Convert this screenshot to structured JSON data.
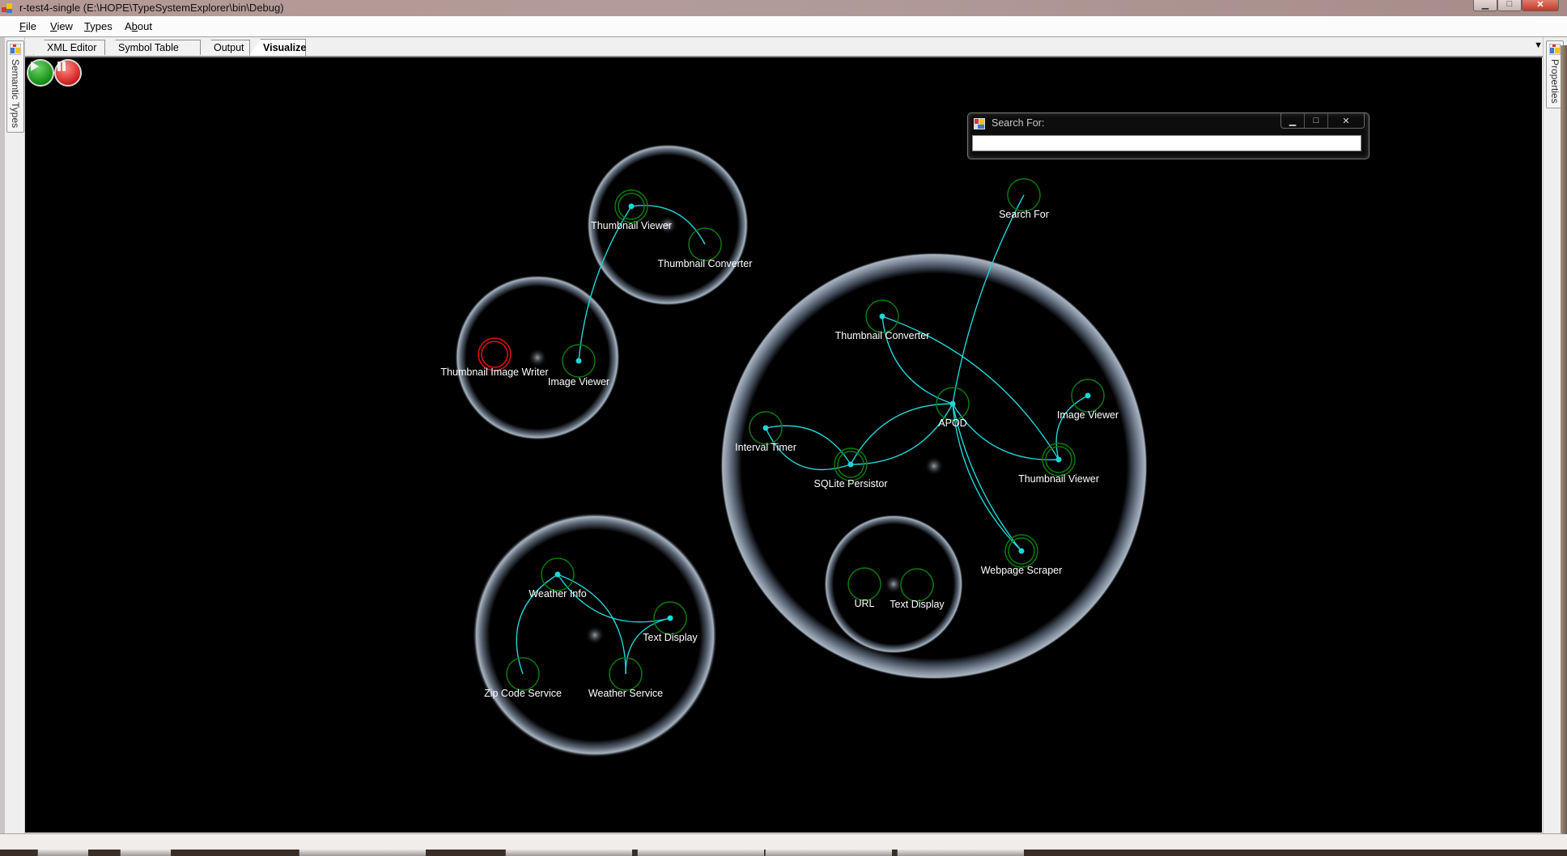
{
  "window": {
    "title": "r-test4-single (E:\\HOPE\\TypeSystemExplorer\\bin\\Debug)",
    "controls": {
      "minimize": "▁",
      "maximize": "□",
      "close": "✕"
    }
  },
  "menu": [
    {
      "label": "File",
      "accel": "F",
      "rest": "ile"
    },
    {
      "label": "View",
      "accel": "V",
      "rest": "iew"
    },
    {
      "label": "Types",
      "accel": "T",
      "rest": "ypes"
    },
    {
      "label": "About",
      "accel_pre": "A",
      "accel": "b",
      "rest": "out"
    }
  ],
  "left_dock": {
    "label": "Semantic Types"
  },
  "right_dock": {
    "label": "Properties"
  },
  "tabs": [
    {
      "label": "XML Editor",
      "active": false
    },
    {
      "label": "Symbol Table",
      "active": false
    },
    {
      "label": "Output",
      "active": false
    },
    {
      "label": "Visualizer",
      "active": true
    }
  ],
  "tab_controls": {
    "menu": "▼",
    "close": "✕"
  },
  "visualizer": {
    "play_button": {
      "icon": "play-icon",
      "color": "#1a9a18"
    },
    "pause_button": {
      "icon": "pause-icon",
      "color": "#d42020"
    },
    "colors": {
      "node_ring": "#0c7a0c",
      "node_ring_error": "#e01010",
      "connection": "#1ed6d6",
      "group_ring": "#8a96a4",
      "label": "#ffffff"
    },
    "groups": [
      {
        "id": "g-thumb-viewer",
        "nodes": [
          "tv1",
          "tc1"
        ]
      },
      {
        "id": "g-image-writer",
        "nodes": [
          "tiw",
          "iv1"
        ]
      },
      {
        "id": "g-apod",
        "nodes": [
          "tc2",
          "apod",
          "it",
          "sql",
          "iv2",
          "tv2",
          "ws"
        ]
      },
      {
        "id": "g-url",
        "nodes": [
          "url",
          "td2"
        ]
      },
      {
        "id": "g-weather",
        "nodes": [
          "wi",
          "td1",
          "zip",
          "wsvc"
        ]
      }
    ],
    "nodes": [
      {
        "id": "tv1",
        "label": "Thumbnail Viewer",
        "state": "double",
        "active": true
      },
      {
        "id": "tc1",
        "label": "Thumbnail Converter",
        "state": "single",
        "active": false
      },
      {
        "id": "tiw",
        "label": "Thumbnail Image Writer",
        "state": "error",
        "active": false
      },
      {
        "id": "iv1",
        "label": "Image Viewer",
        "state": "single",
        "active": true
      },
      {
        "id": "sf",
        "label": "Search For",
        "state": "single",
        "active": false
      },
      {
        "id": "tc2",
        "label": "Thumbnail Converter",
        "state": "single",
        "active": true
      },
      {
        "id": "apod",
        "label": "APOD",
        "state": "single",
        "active": true
      },
      {
        "id": "it",
        "label": "Interval Timer",
        "state": "single",
        "active": true
      },
      {
        "id": "sql",
        "label": "SQLite Persistor",
        "state": "double",
        "active": true
      },
      {
        "id": "iv2",
        "label": "Image Viewer",
        "state": "single",
        "active": true
      },
      {
        "id": "tv2",
        "label": "Thumbnail Viewer",
        "state": "double",
        "active": true
      },
      {
        "id": "ws",
        "label": "Webpage Scraper",
        "state": "double",
        "active": true
      },
      {
        "id": "url",
        "label": "URL",
        "state": "single",
        "active": false
      },
      {
        "id": "td2",
        "label": "Text Display",
        "state": "single",
        "active": false
      },
      {
        "id": "wi",
        "label": "Weather Info",
        "state": "single",
        "active": true
      },
      {
        "id": "td1",
        "label": "Text Display",
        "state": "single",
        "active": true
      },
      {
        "id": "zip",
        "label": "Zip Code Service",
        "state": "single",
        "active": false
      },
      {
        "id": "wsvc",
        "label": "Weather Service",
        "state": "single",
        "active": false
      }
    ],
    "connections": [
      [
        "tc1",
        "tv1"
      ],
      [
        "iv1",
        "tv1"
      ],
      [
        "sf",
        "apod"
      ],
      [
        "tc2",
        "apod"
      ],
      [
        "tc2",
        "tv2"
      ],
      [
        "it",
        "sql"
      ],
      [
        "sql",
        "it"
      ],
      [
        "sql",
        "apod"
      ],
      [
        "apod",
        "sql"
      ],
      [
        "apod",
        "tv2"
      ],
      [
        "iv2",
        "tv2"
      ],
      [
        "apod",
        "ws"
      ],
      [
        "ws",
        "apod"
      ],
      [
        "zip",
        "wi"
      ],
      [
        "wsvc",
        "wi"
      ],
      [
        "wi",
        "td1"
      ],
      [
        "wsvc",
        "td1"
      ]
    ]
  },
  "search_dialog": {
    "title": "Search For:",
    "value": "",
    "controls": {
      "minimize": "▁",
      "maximize": "□",
      "close": "✕"
    }
  }
}
